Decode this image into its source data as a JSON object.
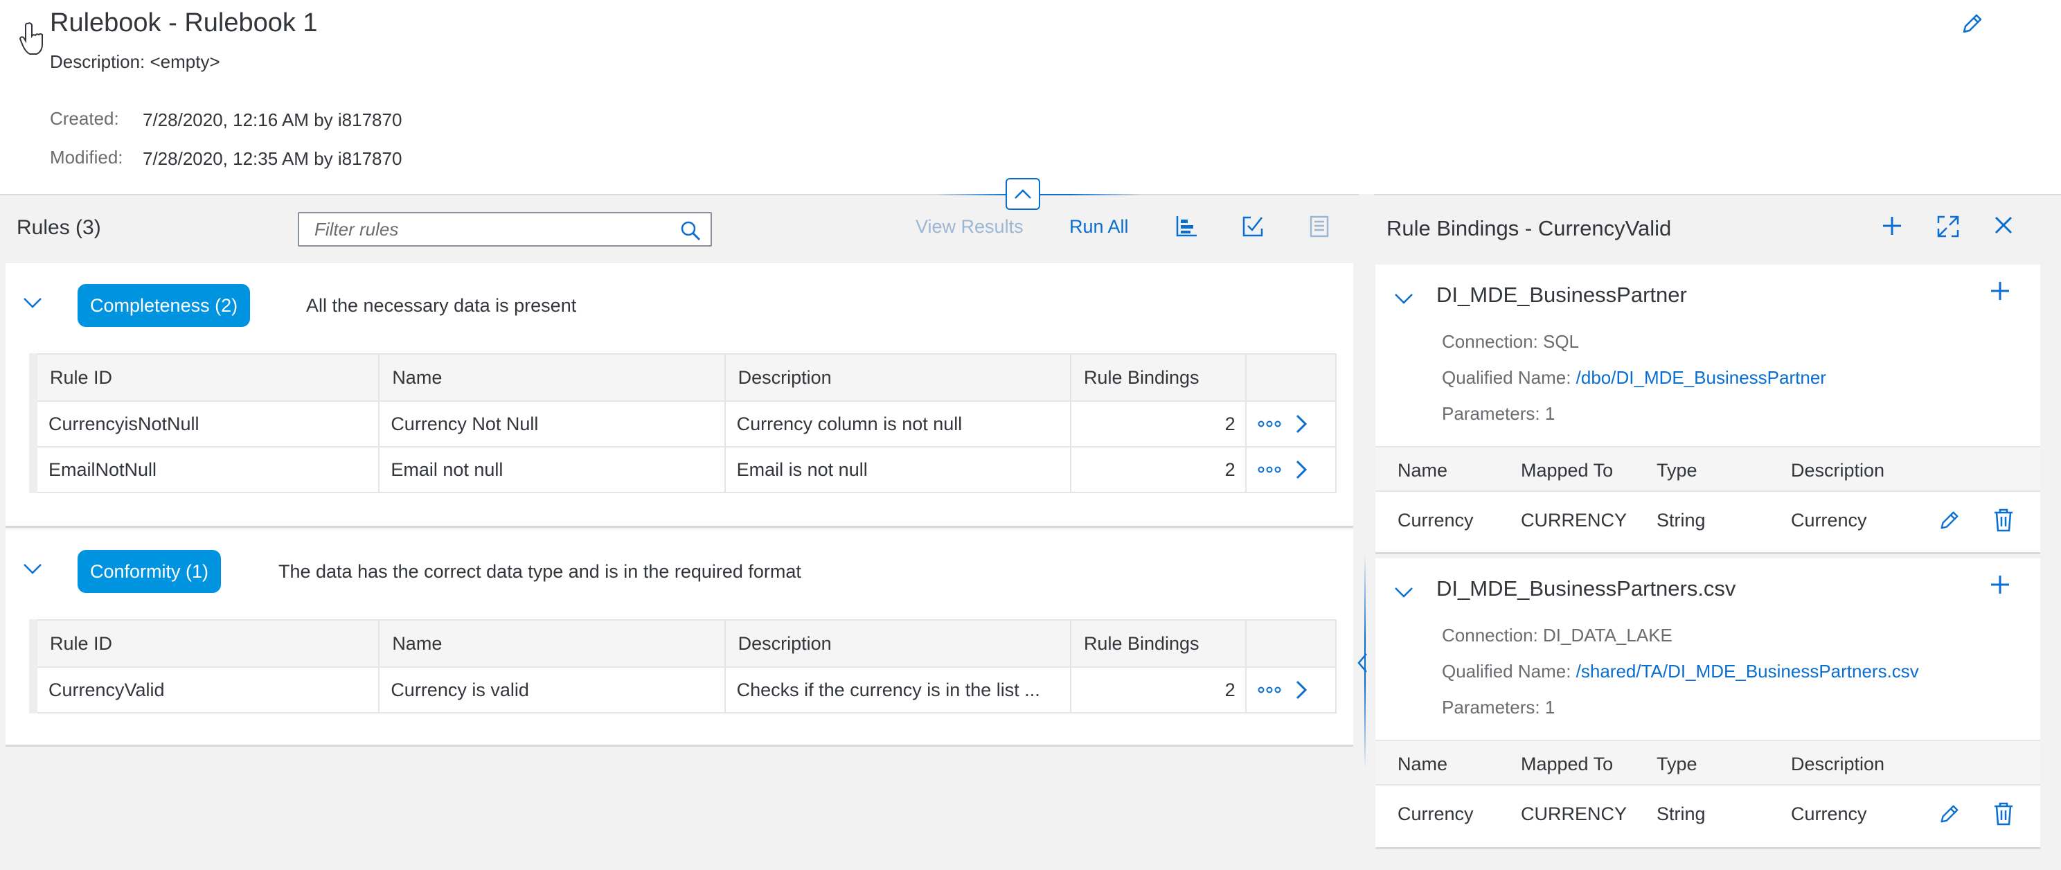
{
  "header": {
    "title": "Rulebook - Rulebook 1",
    "description": "Description: <empty>",
    "created_label": "Created:",
    "created_value": "7/28/2020, 12:16 AM by i817870",
    "modified_label": "Modified:",
    "modified_value": "7/28/2020, 12:35 AM by i817870",
    "edit_icon": "pencil-icon",
    "collapse_icon": "chevron-up-icon"
  },
  "rules_panel": {
    "title": "Rules (3)",
    "filter_placeholder": "Filter rules",
    "filter_value": "",
    "view_results_label": "View Results",
    "run_all_label": "Run All",
    "toolbar_icons": [
      "bar-chart-icon",
      "checklist-icon",
      "report-icon"
    ],
    "columns": [
      "Rule ID",
      "Name",
      "Description",
      "Rule Bindings"
    ],
    "categories": [
      {
        "badge": "Completeness (2)",
        "description": "All the necessary data is present",
        "rows": [
          {
            "rule_id": "CurrencyisNotNull",
            "name": "Currency Not Null",
            "description": "Currency column is not null",
            "bindings": "2"
          },
          {
            "rule_id": "EmailNotNull",
            "name": "Email not null",
            "description": "Email is not null",
            "bindings": "2"
          }
        ]
      },
      {
        "badge": "Conformity (1)",
        "description": "The data has the correct data type and is in the required format",
        "rows": [
          {
            "rule_id": "CurrencyValid",
            "name": "Currency is valid",
            "description": "Checks if the currency is in the list ...",
            "bindings": "2"
          }
        ]
      }
    ]
  },
  "bindings_panel": {
    "title": "Rule Bindings - CurrencyValid",
    "columns": [
      "Name",
      "Mapped To",
      "Type",
      "Description"
    ],
    "bindings": [
      {
        "title": "DI_MDE_BusinessPartner",
        "connection": "Connection: SQL",
        "qualified_label": "Qualified Name:",
        "qualified_value": "/dbo/DI_MDE_BusinessPartner",
        "parameters": "Parameters: 1",
        "rows": [
          {
            "name": "Currency",
            "mapped_to": "CURRENCY",
            "type": "String",
            "description": "Currency"
          }
        ]
      },
      {
        "title": "DI_MDE_BusinessPartners.csv",
        "connection": "Connection: DI_DATA_LAKE",
        "qualified_label": "Qualified Name:",
        "qualified_value": "/shared/TA/DI_MDE_BusinessPartners.csv",
        "parameters": "Parameters: 1",
        "rows": [
          {
            "name": "Currency",
            "mapped_to": "CURRENCY",
            "type": "String",
            "description": "Currency"
          }
        ]
      }
    ]
  },
  "colors": {
    "accent": "#0a6ed1",
    "badge": "#0093e0",
    "disabled_link": "#9cb7d3",
    "text": "#32363a",
    "muted": "#6a6d70"
  }
}
